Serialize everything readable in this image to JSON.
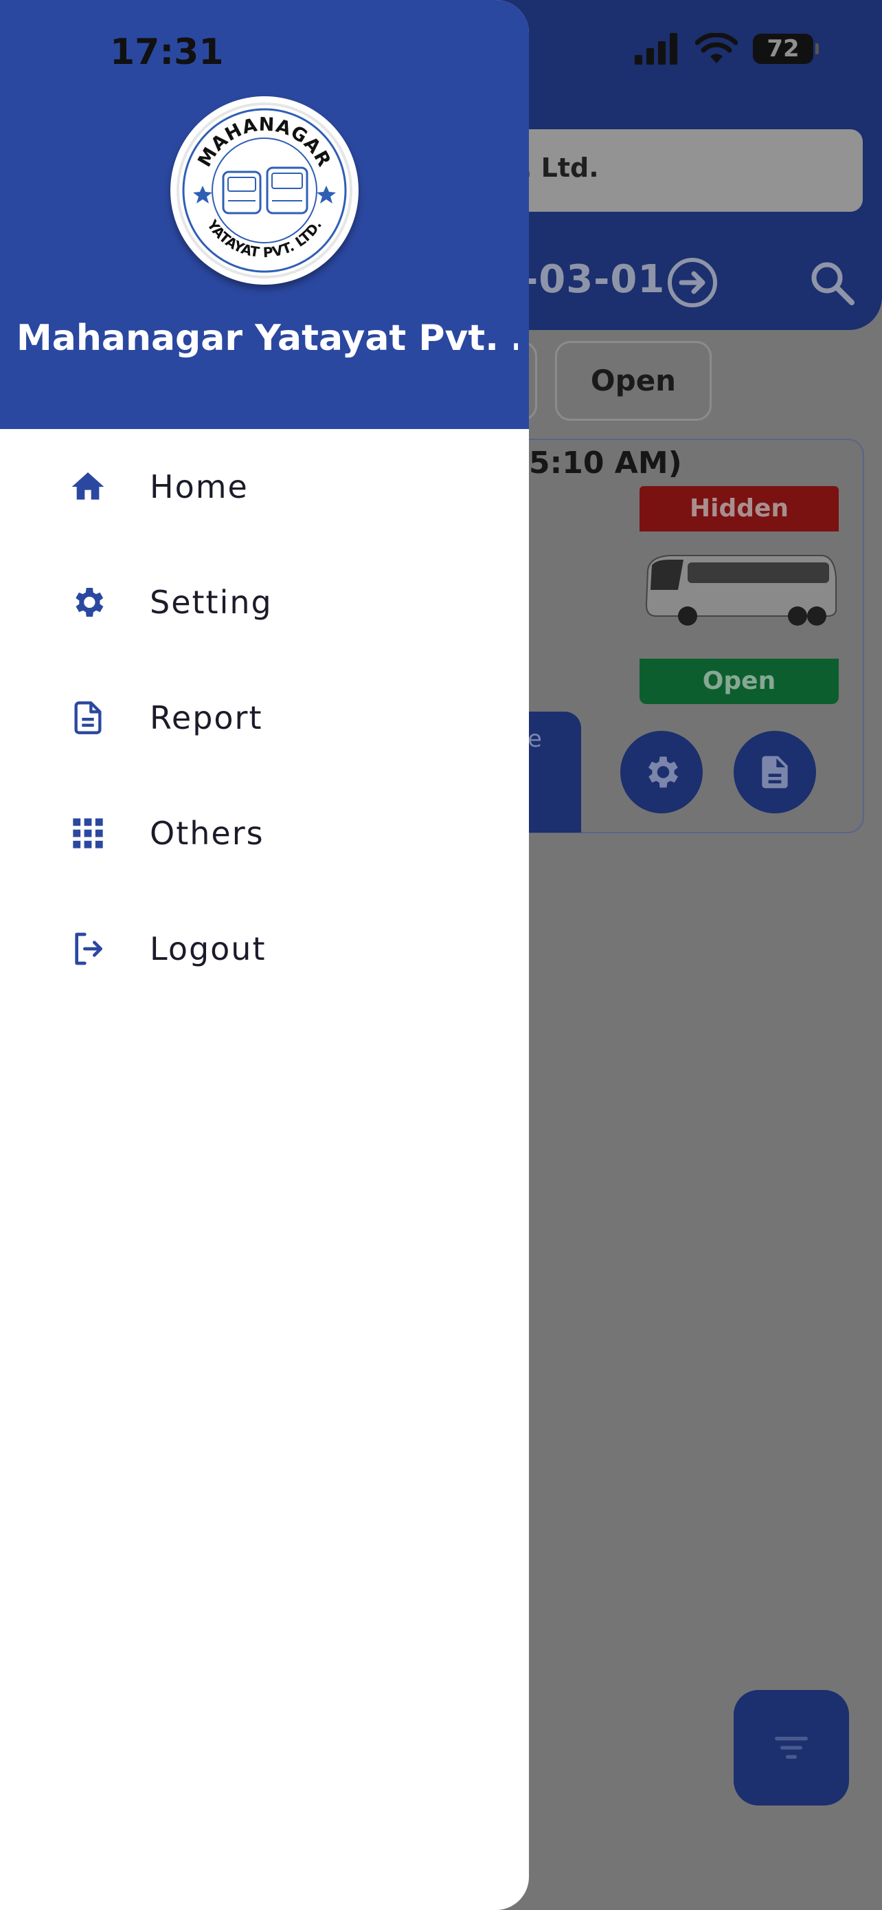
{
  "status_bar": {
    "time": "17:31",
    "battery": "72"
  },
  "background_app": {
    "search_text": ". Ltd.",
    "date": "-03-01",
    "chip_open": "Open",
    "card_time": "5:10 AM)",
    "hidden_label": "Hidden",
    "open_label": "Open",
    "tab_partial": "e"
  },
  "drawer": {
    "logo_top_text": "MAHANAGAR",
    "logo_bottom_text": "YATAYAT PVT. LTD.",
    "company_name": "Mahanagar Yatayat Pvt. …",
    "menu": [
      {
        "label": "Home",
        "icon": "home-icon"
      },
      {
        "label": "Setting",
        "icon": "gear-icon"
      },
      {
        "label": "Report",
        "icon": "document-icon"
      },
      {
        "label": "Others",
        "icon": "grid-icon"
      },
      {
        "label": "Logout",
        "icon": "logout-icon"
      }
    ]
  },
  "colors": {
    "drawer_header": "#2b48a0",
    "accent": "#2b48a0",
    "dim_overlay": "#757575",
    "app_navy": "#1c2f6e"
  }
}
